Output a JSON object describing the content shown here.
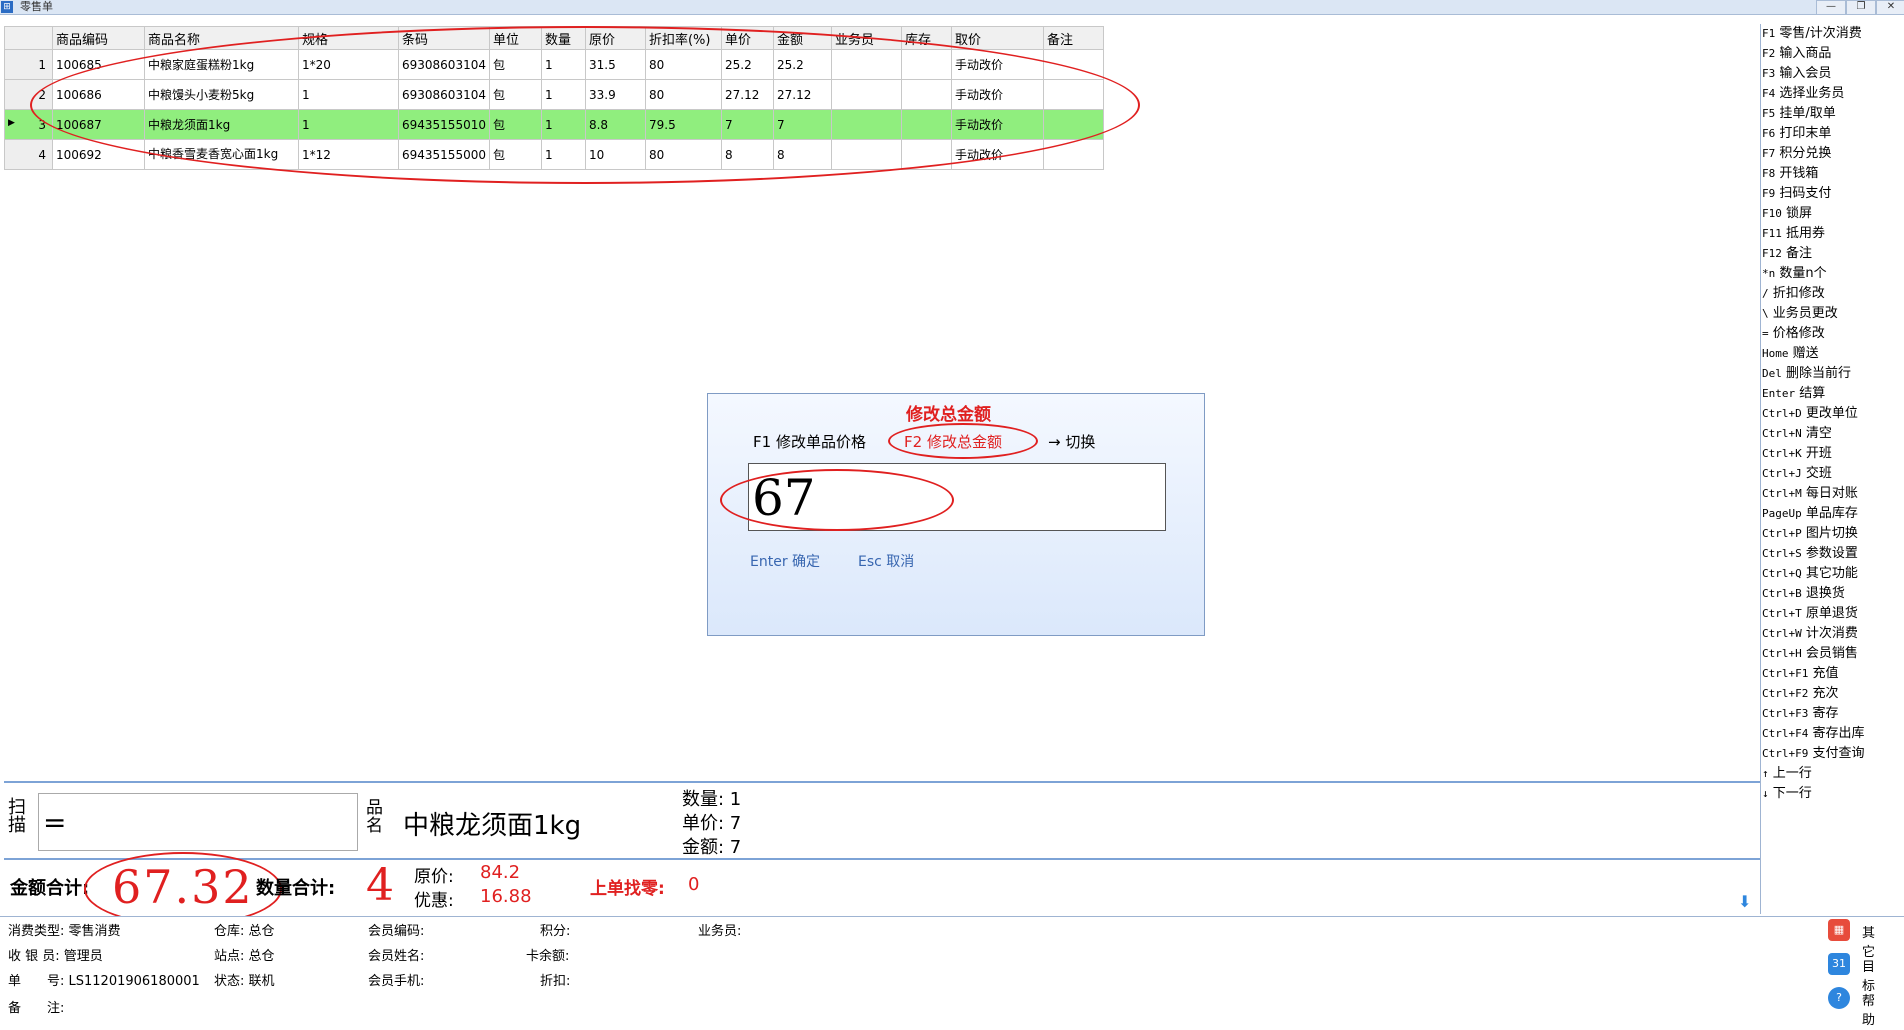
{
  "window": {
    "title": "零售单",
    "icon_name": "app-icon"
  },
  "grid": {
    "headers": [
      "",
      "商品编码",
      "商品名称",
      "规格",
      "条码",
      "单位",
      "数量",
      "原价",
      "折扣率(%)",
      "单价",
      "金额",
      "业务员",
      "库存",
      "取价",
      "备注"
    ],
    "rows": [
      {
        "no": "1",
        "code": "100685",
        "name": "中粮家庭蛋糕粉1kg",
        "spec": "1*20",
        "barcode": "69308603104",
        "unit": "包",
        "qty": "1",
        "orig": "31.5",
        "rate": "80",
        "price": "25.2",
        "amount": "25.2",
        "clerk": "",
        "stock": "",
        "pricing": "手动改价",
        "note": ""
      },
      {
        "no": "2",
        "code": "100686",
        "name": "中粮馒头小麦粉5kg",
        "spec": "1",
        "barcode": "69308603104",
        "unit": "包",
        "qty": "1",
        "orig": "33.9",
        "rate": "80",
        "price": "27.12",
        "amount": "27.12",
        "clerk": "",
        "stock": "",
        "pricing": "手动改价",
        "note": ""
      },
      {
        "no": "3",
        "code": "100687",
        "name": "中粮龙须面1kg",
        "spec": "1",
        "barcode": "69435155010",
        "unit": "包",
        "qty": "1",
        "orig": "8.8",
        "rate": "79.5",
        "price": "7",
        "amount": "7",
        "clerk": "",
        "stock": "",
        "pricing": "手动改价",
        "note": "",
        "selected": true
      },
      {
        "no": "4",
        "code": "100692",
        "name": "中粮香雪麦香宽心面1kg",
        "spec": "1*12",
        "barcode": "69435155000",
        "unit": "包",
        "qty": "1",
        "orig": "10",
        "rate": "80",
        "price": "8",
        "amount": "8",
        "clerk": "",
        "stock": "",
        "pricing": "手动改价",
        "note": ""
      }
    ]
  },
  "functions": [
    {
      "key": "F1",
      "label": "零售/计次消费"
    },
    {
      "key": "F2",
      "label": "输入商品"
    },
    {
      "key": "F3",
      "label": "输入会员"
    },
    {
      "key": "F4",
      "label": "选择业务员"
    },
    {
      "key": "F5",
      "label": "挂单/取单"
    },
    {
      "key": "F6",
      "label": "打印末单"
    },
    {
      "key": "F7",
      "label": "积分兑换"
    },
    {
      "key": "F8",
      "label": "开钱箱"
    },
    {
      "key": "F9",
      "label": "扫码支付"
    },
    {
      "key": "F10",
      "label": "锁屏"
    },
    {
      "key": "F11",
      "label": "抵用券"
    },
    {
      "key": "F12",
      "label": "备注"
    },
    {
      "key": "*n",
      "label": "数量n个"
    },
    {
      "key": "/",
      "label": "折扣修改"
    },
    {
      "key": "\\",
      "label": "业务员更改"
    },
    {
      "key": "=",
      "label": "价格修改"
    },
    {
      "key": "Home",
      "label": "赠送"
    },
    {
      "key": "Del",
      "label": "删除当前行"
    },
    {
      "key": "Enter",
      "label": "结算"
    },
    {
      "key": "Ctrl+D",
      "label": "更改单位"
    },
    {
      "key": "Ctrl+N",
      "label": "清空"
    },
    {
      "key": "Ctrl+K",
      "label": "开班"
    },
    {
      "key": "Ctrl+J",
      "label": "交班"
    },
    {
      "key": "Ctrl+M",
      "label": "每日对账"
    },
    {
      "key": "PageUp",
      "label": "单品库存"
    },
    {
      "key": "Ctrl+P",
      "label": "图片切换"
    },
    {
      "key": "Ctrl+S",
      "label": "参数设置"
    },
    {
      "key": "Ctrl+Q",
      "label": "其它功能"
    },
    {
      "key": "Ctrl+B",
      "label": "退换货"
    },
    {
      "key": "Ctrl+T",
      "label": "原单退货"
    },
    {
      "key": "Ctrl+W",
      "label": "计次消费"
    },
    {
      "key": "Ctrl+H",
      "label": "会员销售"
    },
    {
      "key": "Ctrl+F1",
      "label": "充值"
    },
    {
      "key": "Ctrl+F2",
      "label": "充次"
    },
    {
      "key": "Ctrl+F3",
      "label": "寄存"
    },
    {
      "key": "Ctrl+F4",
      "label": "寄存出库"
    },
    {
      "key": "Ctrl+F9",
      "label": "支付查询"
    },
    {
      "key": "↑",
      "label": "上一行"
    },
    {
      "key": "↓",
      "label": "下一行"
    }
  ],
  "dialog": {
    "mode_title": "修改总金额",
    "f1_label": "F1 修改单品价格",
    "f2_label": "F2 修改总金额",
    "switch_label": "→ 切换",
    "input_value": "67",
    "enter_label": "Enter 确定",
    "esc_label": "Esc 取消"
  },
  "scan": {
    "label": "扫描",
    "input_value": "=",
    "name_label": "品名",
    "product_name": "中粮龙须面1kg",
    "qty": "数量: 1",
    "price": "单价: 7",
    "amount": "金额: 7"
  },
  "totals": {
    "amount_label": "金额合计:",
    "amount": "67.32",
    "qty_label": "数量合计:",
    "qty": "4",
    "orig_label": "原价:",
    "orig": "84.2",
    "discount_label": "优惠:",
    "discount": "16.88",
    "change_label": "上单找零:",
    "change": "0"
  },
  "info": {
    "type": "消费类型: 零售消费",
    "cashier": "收 银 员: 管理员",
    "order_no": "单　　号: LS11201906180001",
    "remark": "备　　注:",
    "warehouse": "仓库: 总仓",
    "station": "站点: 总仓",
    "status": "状态: 联机",
    "member_code": "会员编码:",
    "member_name": "会员姓名:",
    "member_phone": "会员手机:",
    "points": "积分:",
    "card_balance": "卡余额:",
    "discount": "折扣:",
    "clerk": "业务员:"
  },
  "side_buttons": [
    {
      "label": "其它",
      "icon": "grid-icon",
      "color": "#e74c3c"
    },
    {
      "label": "目标",
      "icon": "calendar-icon",
      "color": "#2e86de"
    },
    {
      "label": "帮助",
      "icon": "help-icon",
      "color": "#2e86de"
    }
  ],
  "colors": {
    "selected_row": "#90ee7e",
    "annotation": "#e02020",
    "accent": "#2e86de"
  }
}
